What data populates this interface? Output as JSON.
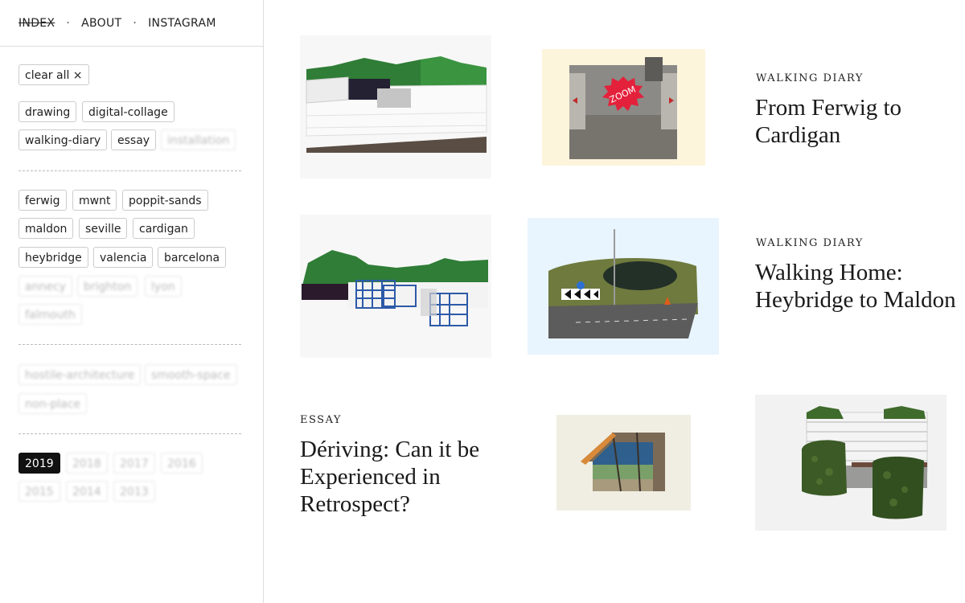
{
  "nav": {
    "index": "INDEX",
    "sep": "·",
    "about": "ABOUT",
    "instagram": "INSTAGRAM"
  },
  "filters": {
    "clear_all": "clear all ×",
    "types": [
      "drawing",
      "digital-collage",
      "walking-diary",
      "essay",
      "installation"
    ],
    "places": [
      "ferwig",
      "mwnt",
      "poppit-sands",
      "maldon",
      "seville",
      "cardigan",
      "heybridge",
      "valencia",
      "barcelona",
      "annecy",
      "brighton",
      "lyon",
      "falmouth"
    ],
    "concepts": [
      "hostile-architecture",
      "smooth-space",
      "non-place"
    ],
    "years": [
      "2019",
      "2018",
      "2017",
      "2016",
      "2015",
      "2014",
      "2013"
    ],
    "active_year": "2019"
  },
  "posts": [
    {
      "category": "WALKING DIARY",
      "title": "From Ferwig to Cardigan",
      "thumb_label": "ZOOM"
    },
    {
      "category": "WALKING DIARY",
      "title": "Walking Home: Heybridge to Maldon"
    },
    {
      "category": "ESSAY",
      "title": "Dériving: Can it be Experienced in Retrospect?"
    }
  ],
  "colors": {
    "accent": "#e4213b",
    "active_tag": "#111111",
    "cream": "#fdf4dc",
    "light_blue": "#e8f5fe",
    "beige": "#f0eee3"
  }
}
